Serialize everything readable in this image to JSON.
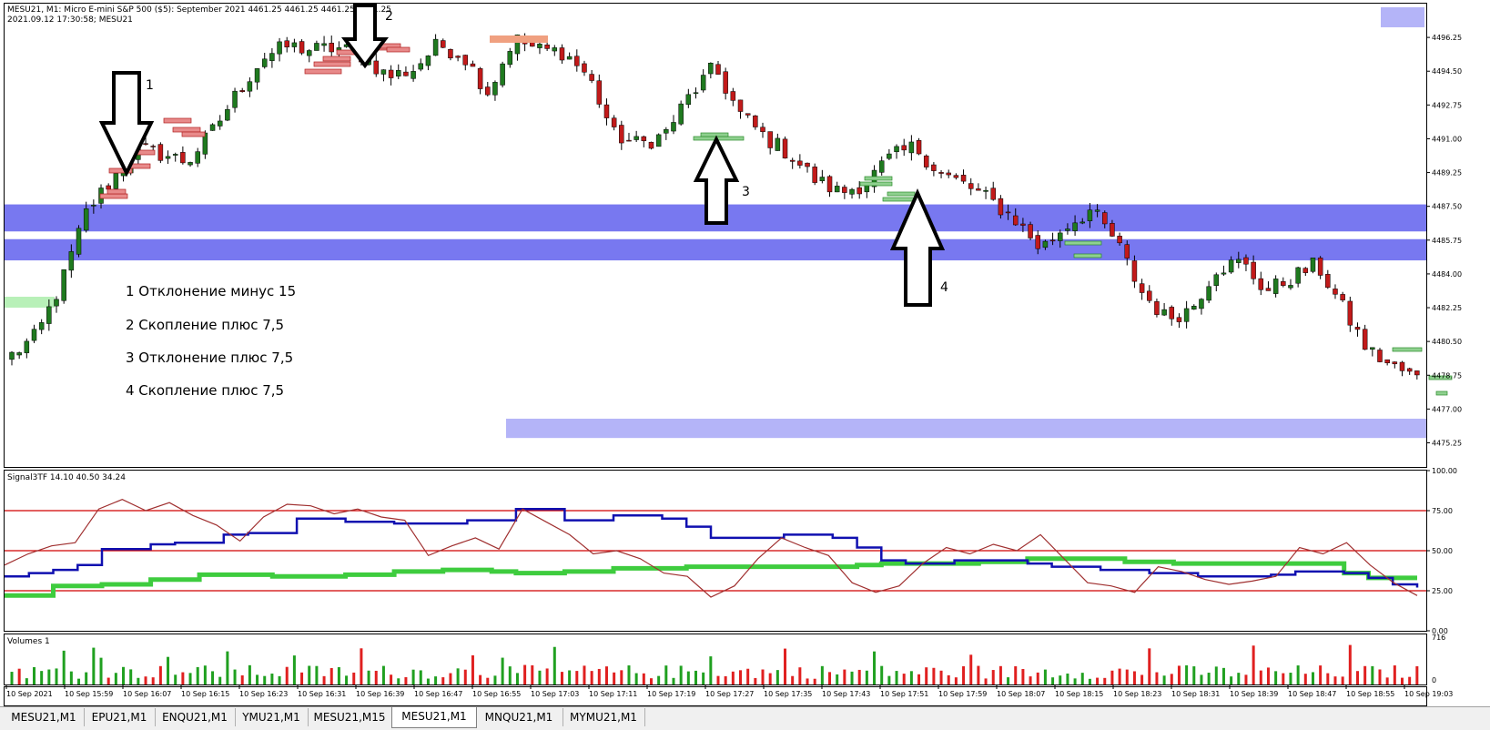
{
  "header": {
    "line1": "MESU21, M1:  Micro E-mini S&P 500 ($5): September 2021  4461.25 4461.25 4461.25 4461.25",
    "line2": "2021.09.12 17:30:58; MESU21"
  },
  "annotations": {
    "a1": "1",
    "a2": "2",
    "a3": "3",
    "a4": "4",
    "notes": [
      "1 Отклонение минус 15",
      "2 Скопление плюс 7,5",
      "3 Отклонение плюс 7,5",
      "4 Скопление плюс 7,5"
    ]
  },
  "colors": {
    "bull": "#1f7a1f",
    "bear": "#c21a1a",
    "zone": "#7878f0",
    "zone_light": "#b4b4f8",
    "rsi": "#a03030",
    "blue_line": "#1010b0",
    "green_line": "#3ecc3e",
    "level": "#d00000"
  },
  "chart_data": [
    {
      "type": "candlestick",
      "symbol": "MESU21, M1",
      "y_ticks": [
        "4496.25",
        "4494.50",
        "4492.75",
        "4491.00",
        "4489.25",
        "4487.50",
        "4485.75",
        "4484.00",
        "4482.25",
        "4480.50",
        "4478.75",
        "4477.00",
        "4475.25"
      ],
      "ylim": [
        4474.0,
        4498.0
      ],
      "x_ticks": [
        "10 Sep 2021",
        "10 Sep 15:59",
        "10 Sep 16:07",
        "10 Sep 16:15",
        "10 Sep 16:23",
        "10 Sep 16:31",
        "10 Sep 16:39",
        "10 Sep 16:47",
        "10 Sep 16:55",
        "10 Sep 17:03",
        "10 Sep 17:11",
        "10 Sep 17:19",
        "10 Sep 17:27",
        "10 Sep 17:35",
        "10 Sep 17:43",
        "10 Sep 17:51",
        "10 Sep 17:59",
        "10 Sep 18:07",
        "10 Sep 18:15",
        "10 Sep 18:23",
        "10 Sep 18:31",
        "10 Sep 18:39",
        "10 Sep 18:47",
        "10 Sep 18:55",
        "10 Sep 19:03"
      ],
      "zones": [
        {
          "from": 4486.2,
          "to": 4487.6
        },
        {
          "from": 4484.7,
          "to": 4485.8
        },
        {
          "from": 4475.5,
          "to": 4476.5,
          "light": true
        }
      ],
      "close_anchors": [
        4479.8,
        4480.8,
        4483.6,
        4487.3,
        4488.9,
        4490.5,
        4490.2,
        4489.8,
        4491.4,
        4493.4,
        4495.2,
        4495.8,
        4495.6,
        4495.7,
        4495.3,
        4494.2,
        4494.6,
        4495.9,
        4495.3,
        4493.4,
        4496.2,
        4495.6,
        4495.5,
        4494.2,
        4491.2,
        4490.7,
        4491.2,
        4493.2,
        4494.7,
        4492.3,
        4491.1,
        4490.2,
        4488.9,
        4488.2,
        4488.7,
        4490.0,
        4490.6,
        4489.2,
        4488.6,
        4487.8,
        4486.8,
        4485.3,
        4486.5,
        4487.3,
        4485.7,
        4483.1,
        4481.7,
        4482.2,
        4484.3,
        4484.6,
        4483.1,
        4483.8,
        4484.5,
        4482.3,
        4480.1,
        4479.2,
        4478.6
      ]
    },
    {
      "type": "line",
      "title": "Signal3TF 14.10 40.50 34.24",
      "y_ticks": [
        "100.00",
        "75.00",
        "50.00",
        "25.00",
        "0.00"
      ],
      "ylim": [
        0,
        100
      ],
      "levels": [
        75,
        50,
        25
      ],
      "series": [
        {
          "values": [
            34,
            36,
            38,
            41,
            51,
            51,
            54,
            55,
            55,
            60,
            61,
            61,
            70,
            70,
            68,
            68,
            67,
            67,
            67,
            69,
            69,
            76,
            76,
            69,
            69,
            72,
            72,
            70,
            65,
            58,
            58,
            58,
            60,
            60,
            58,
            52,
            44,
            42,
            42,
            44,
            44,
            44,
            42,
            40,
            40,
            38,
            38,
            36,
            36,
            34,
            34,
            34,
            35,
            37,
            37,
            36,
            33,
            29,
            27
          ]
        },
        {
          "values": [
            22,
            22,
            28,
            28,
            29,
            29,
            32,
            32,
            35,
            35,
            35,
            34,
            34,
            34,
            35,
            35,
            37,
            37,
            38,
            38,
            37,
            36,
            36,
            37,
            37,
            39,
            39,
            39,
            40,
            40,
            40,
            40,
            40,
            40,
            40,
            41,
            42,
            42,
            42,
            42,
            43,
            43,
            45,
            45,
            45,
            45,
            43,
            43,
            42,
            42,
            42,
            42,
            42,
            42,
            42,
            36,
            33,
            33,
            33
          ]
        },
        {
          "values": [
            41,
            48,
            53,
            55,
            76,
            82,
            75,
            80,
            72,
            66,
            56,
            71,
            79,
            78,
            73,
            76,
            71,
            69,
            47,
            53,
            58,
            51,
            76,
            68,
            60,
            48,
            50,
            45,
            36,
            34,
            21,
            28,
            45,
            58,
            52,
            47,
            30,
            24,
            28,
            42,
            52,
            48,
            54,
            50,
            60,
            45,
            30,
            28,
            24,
            40,
            37,
            32,
            29,
            31,
            34,
            52,
            48,
            55,
            41,
            30,
            22
          ]
        }
      ]
    },
    {
      "type": "bar",
      "title": "Volumes 1",
      "y_ticks": [
        "716",
        "0"
      ],
      "ylim": [
        0,
        716
      ]
    }
  ],
  "tabs": [
    "MESU21,M1",
    "EPU21,M1",
    "ENQU21,M1",
    "YMU21,M1",
    "MESU21,M15",
    "MESU21,M1",
    "MNQU21,M1",
    "MYMU21,M1"
  ]
}
